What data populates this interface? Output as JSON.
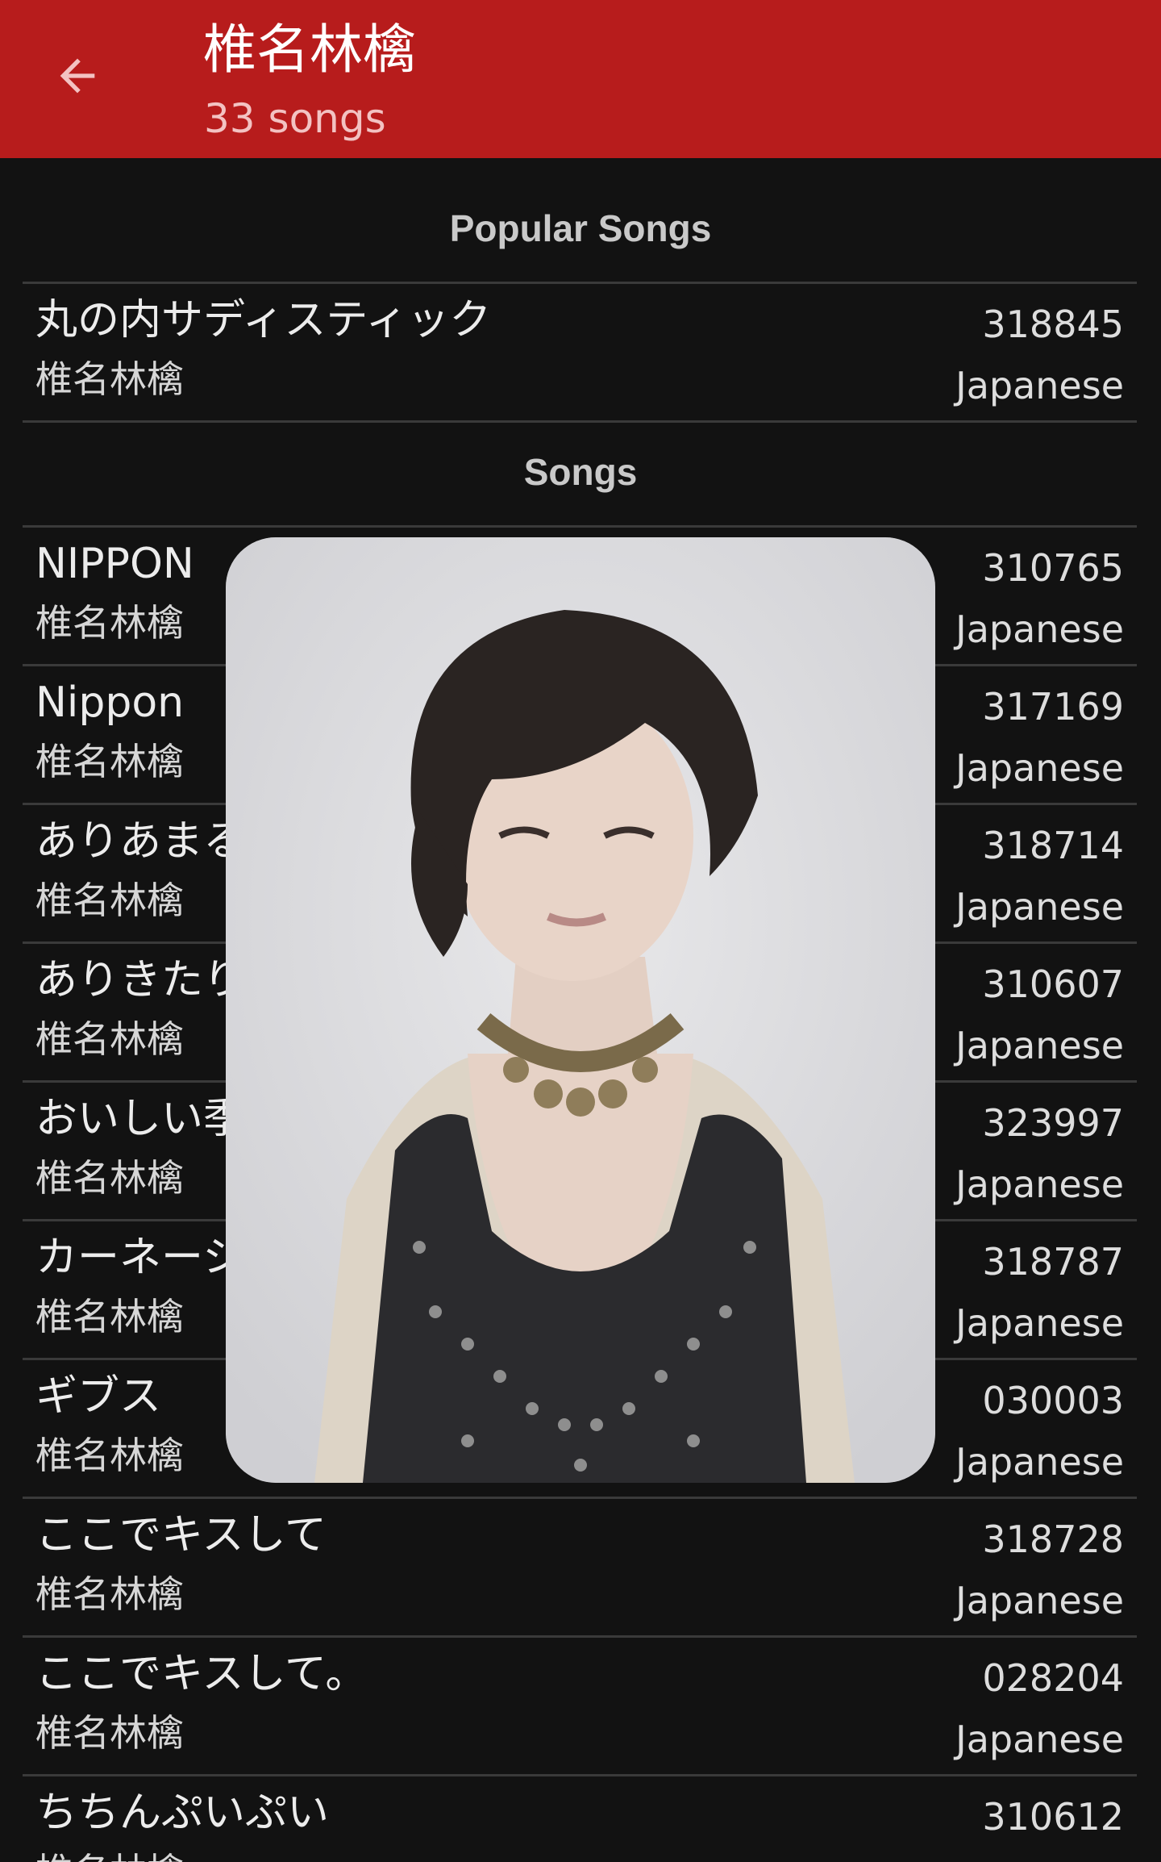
{
  "header": {
    "title": "椎名林檎",
    "subtitle": "33 songs",
    "back_icon": "arrow-left-icon",
    "background_color": "#b71c1c"
  },
  "sections": {
    "popular_label": "Popular Songs",
    "songs_label": "Songs"
  },
  "popular_songs": [
    {
      "title": "丸の内サディスティック",
      "artist": "椎名林檎",
      "id": "318845",
      "language": "Japanese"
    }
  ],
  "songs": [
    {
      "title": "NIPPON",
      "artist": "椎名林檎",
      "id": "310765",
      "language": "Japanese"
    },
    {
      "title": "Nippon",
      "artist": "椎名林檎",
      "id": "317169",
      "language": "Japanese"
    },
    {
      "title": "ありあまる富",
      "artist": "椎名林檎",
      "id": "318714",
      "language": "Japanese"
    },
    {
      "title": "ありきたりな女",
      "artist": "椎名林檎",
      "id": "310607",
      "language": "Japanese"
    },
    {
      "title": "おいしい季節",
      "artist": "椎名林檎",
      "id": "323997",
      "language": "Japanese"
    },
    {
      "title": "カーネーション",
      "artist": "椎名林檎",
      "id": "318787",
      "language": "Japanese"
    },
    {
      "title": "ギブス",
      "artist": "椎名林檎",
      "id": "030003",
      "language": "Japanese"
    },
    {
      "title": "ここでキスして",
      "artist": "椎名林檎",
      "id": "318728",
      "language": "Japanese"
    },
    {
      "title": "ここでキスして。",
      "artist": "椎名林檎",
      "id": "028204",
      "language": "Japanese"
    },
    {
      "title": "ちちんぷいぷい",
      "artist": "椎名林檎",
      "id": "310612",
      "language": "Japanese"
    }
  ],
  "overlay": {
    "image": "artist-photo"
  }
}
